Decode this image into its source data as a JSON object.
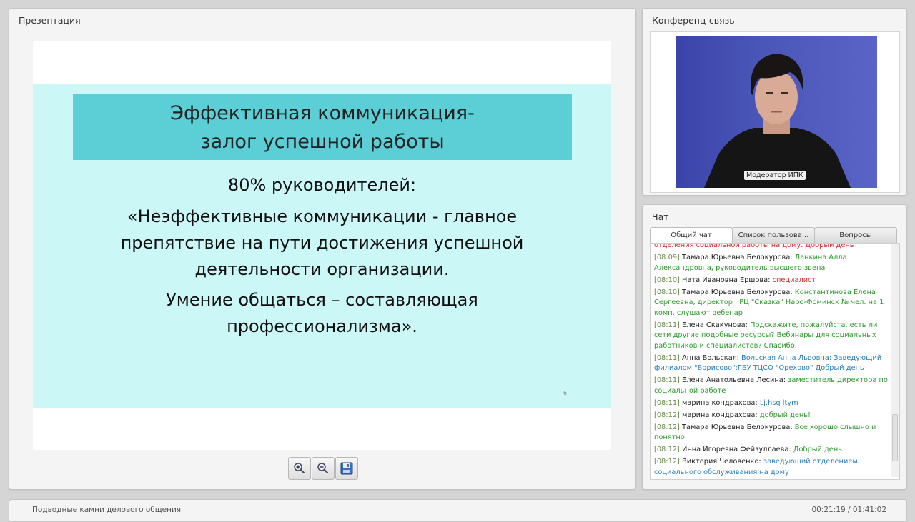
{
  "presentation": {
    "title": "Презентация",
    "slide": {
      "heading_line1": "Эффективная коммуникация-",
      "heading_line2": "залог успешной работы",
      "line1": "80% руководителей:",
      "line2": "«Неэффективные коммуникации - главное",
      "line3": "препятствие на пути достижения успешной",
      "line4": "деятельности организации.",
      "line5": "Умение общаться – составляющая",
      "line6": "профессионализма».",
      "page_number": "6",
      "colors": {
        "banner": "#5ccfd6",
        "background": "#ccf7f7"
      }
    },
    "toolbar": {
      "zoom_in": "zoom-in-icon",
      "zoom_out": "zoom-out-icon",
      "save": "save-icon"
    }
  },
  "conference": {
    "title": "Конференц-связь",
    "video_label": "Модератор ИПК"
  },
  "chat": {
    "title": "Чат",
    "tabs": [
      "Общий чат",
      "Список пользова...",
      "Вопросы"
    ],
    "messages": [
      {
        "time": "",
        "user": "",
        "text": "отделения социальной работы на дому. Добрый день",
        "color": "#cc2a2a"
      },
      {
        "time": "[08:09]",
        "user": "Тамара Юрьевна Белокурова:",
        "text": "Ланкина Алла Александровна, руководитель высшего звена",
        "color": "#2e9a2e"
      },
      {
        "time": "[08:10]",
        "user": "Ната Ивановна Ершова:",
        "text": "специалист",
        "color": "#cc2a2a"
      },
      {
        "time": "[08:10]",
        "user": "Тамара Юрьевна Белокурова:",
        "text": "Константинова Елена Сергеевна, директор . РЦ \"Сказка\" Наро-Фоминск № чел. на 1 комп. слушают вебенар",
        "color": "#2e9a2e"
      },
      {
        "time": "[08:11]",
        "user": "Елена Скакунова:",
        "text": "Подскажите, пожалуйста, есть ли сети другие подобные ресурсы? Вебинары для социальных работников и специалистов? Спасибо.",
        "color": "#2e9a2e"
      },
      {
        "time": "[08:11]",
        "user": "Анна Вольская:",
        "text": "Вольская Анна Львовна: Заведующий филиалом \"Борисово\":ГБУ ТЦСО \"Орехово\" Добрый день",
        "color": "#2a7fc0"
      },
      {
        "time": "[08:11]",
        "user": "Елена Анатольевна Лесина:",
        "text": "заместитель директора по социальной работе",
        "color": "#2e9a2e"
      },
      {
        "time": "[08:11]",
        "user": "марина кондрахова:",
        "text": "Lj.hsq ltym",
        "color": "#2a7fc0"
      },
      {
        "time": "[08:12]",
        "user": "марина кондрахова:",
        "text": "добрый день!",
        "color": "#2e9a2e"
      },
      {
        "time": "[08:12]",
        "user": "Тамара Юрьевна Белокурова:",
        "text": "Все хорошо слышно и понятно",
        "color": "#2e9a2e"
      },
      {
        "time": "[08:12]",
        "user": "Инна Игоревна Фейзуллаева:",
        "text": "Добрый день",
        "color": "#2e9a2e"
      },
      {
        "time": "[08:12]",
        "user": "Виктория Человенко:",
        "text": "заведующий отделением социального обслуживания на дому",
        "color": "#2a7fc0"
      }
    ]
  },
  "footer": {
    "webinar_title": "Подводные камни делового общения",
    "time": "00:21:19 / 01:41:02"
  }
}
